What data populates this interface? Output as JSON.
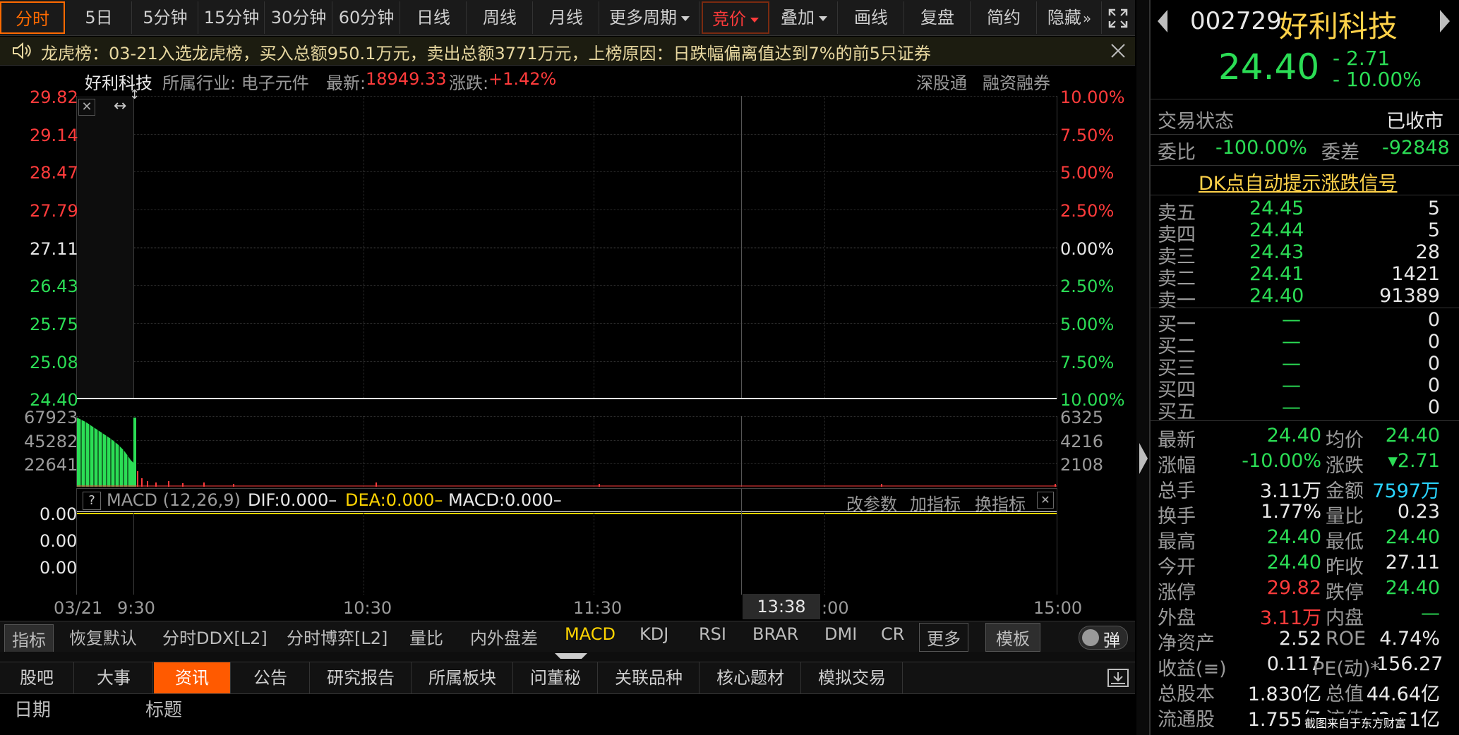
{
  "toolbar": {
    "items": [
      "分时",
      "5日",
      "5分钟",
      "15分钟",
      "30分钟",
      "60分钟",
      "日线",
      "周线",
      "月线",
      "更多周期",
      "竞价",
      "叠加",
      "画线",
      "复盘",
      "简约",
      "隐藏"
    ],
    "fullscreen_icon": "expand-icon",
    "hide_icon": "double-chevron-right-icon"
  },
  "notice": {
    "text": "龙虎榜：03-21入选龙虎榜，买入总额950.1万元，卖出总额3771万元，上榜原因：日跌幅偏离值达到7%的前5只证券",
    "close_icon": "close-icon"
  },
  "chart_header": {
    "name": "好利科技",
    "industry": "所属行业: 电子元件",
    "latest_label": "最新:",
    "latest_value": "18949.33",
    "change_label": "涨跌:",
    "change_value": "+1.42%",
    "tag1": "深股通",
    "tag2": "融资融券"
  },
  "price_axis": {
    "left": [
      "29.82",
      "29.14",
      "28.47",
      "27.79",
      "27.11",
      "26.43",
      "25.75",
      "25.08",
      "24.40"
    ],
    "right": [
      "10.00%",
      "7.50%",
      "5.00%",
      "2.50%",
      "0.00%",
      "2.50%",
      "5.00%",
      "7.50%",
      "10.00%"
    ]
  },
  "volume_axis": {
    "left": [
      "67923",
      "45282",
      "22641"
    ],
    "right": [
      "6325",
      "4216",
      "2108"
    ]
  },
  "macd": {
    "help": "?",
    "name": "MACD (12,26,9)",
    "dif": "DIF:0.000–",
    "dea": "DEA:0.000–",
    "macd": "MACD:0.000–",
    "btn_params": "改参数",
    "btn_add": "加指标",
    "btn_switch": "换指标",
    "axis": [
      "0.00",
      "0.00",
      "0.00"
    ]
  },
  "time_axis": {
    "labels": [
      "03/21",
      "9:30",
      "10:30",
      "11:30",
      ":00",
      "15:00"
    ],
    "cursor": "13:38"
  },
  "indicator_bar": {
    "items": [
      "指标",
      "恢复默认",
      "分时DDX[L2]",
      "分时博弈[L2]",
      "量比",
      "内外盘差",
      "MACD",
      "KDJ",
      "RSI",
      "BRAR",
      "DMI",
      "CR",
      "更多",
      "模板"
    ],
    "toggle_label": "弹"
  },
  "info_tabs": {
    "items": [
      "股吧",
      "大事",
      "资讯",
      "公告",
      "研究报告",
      "所属板块",
      "问董秘",
      "关联品种",
      "核心题材",
      "模拟交易"
    ],
    "active_index": 2,
    "col_date": "日期",
    "col_title": "标题"
  },
  "stock": {
    "code": "002729",
    "name": "好利科技",
    "price": "24.40",
    "change": "- 2.71",
    "change_pct": "- 10.00%",
    "status_label": "交易状态",
    "status_value": "已收市",
    "wb_label": "委比",
    "wb_value": "-100.00%",
    "wc_label": "委差",
    "wc_value": "-92848",
    "signal_link": "DK点自动提示涨跌信号"
  },
  "order_book": {
    "sell": [
      {
        "label": "卖五",
        "price": "24.45",
        "vol": "5"
      },
      {
        "label": "卖四",
        "price": "24.44",
        "vol": "5"
      },
      {
        "label": "卖三",
        "price": "24.43",
        "vol": "28"
      },
      {
        "label": "卖二",
        "price": "24.41",
        "vol": "1421"
      },
      {
        "label": "卖一",
        "price": "24.40",
        "vol": "91389"
      }
    ],
    "buy": [
      {
        "label": "买一",
        "price": "—",
        "vol": "0"
      },
      {
        "label": "买二",
        "price": "—",
        "vol": "0"
      },
      {
        "label": "买三",
        "price": "—",
        "vol": "0"
      },
      {
        "label": "买四",
        "price": "—",
        "vol": "0"
      },
      {
        "label": "买五",
        "price": "—",
        "vol": "0"
      }
    ]
  },
  "quote": [
    [
      "最新",
      "24.40",
      "均价",
      "24.40"
    ],
    [
      "涨幅",
      "-10.00%",
      "涨跌",
      "▾2.71"
    ],
    [
      "总手",
      "3.11万",
      "金额",
      "7597万"
    ],
    [
      "换手",
      "1.77%",
      "量比",
      "0.23"
    ],
    [
      "最高",
      "24.40",
      "最低",
      "24.40"
    ],
    [
      "今开",
      "24.40",
      "昨收",
      "27.11"
    ],
    [
      "涨停",
      "29.82",
      "跌停",
      "24.40"
    ],
    [
      "外盘",
      "3.11万",
      "内盘",
      "—"
    ],
    [
      "净资产",
      "2.52",
      "ROE",
      "4.74%"
    ],
    [
      "收益(≡)",
      "0.117",
      "PE(动)*",
      "156.27"
    ],
    [
      "总股本",
      "1.830亿",
      "总值",
      "44.64亿"
    ],
    [
      "流通股",
      "1.755亿",
      "流值",
      "42.81亿"
    ]
  ],
  "watermark": "截图来自于东方财富",
  "colors": {
    "up": "#ff3b3b",
    "down": "#2bdd55",
    "accent": "#ff5a00",
    "link": "#ffd24a"
  }
}
